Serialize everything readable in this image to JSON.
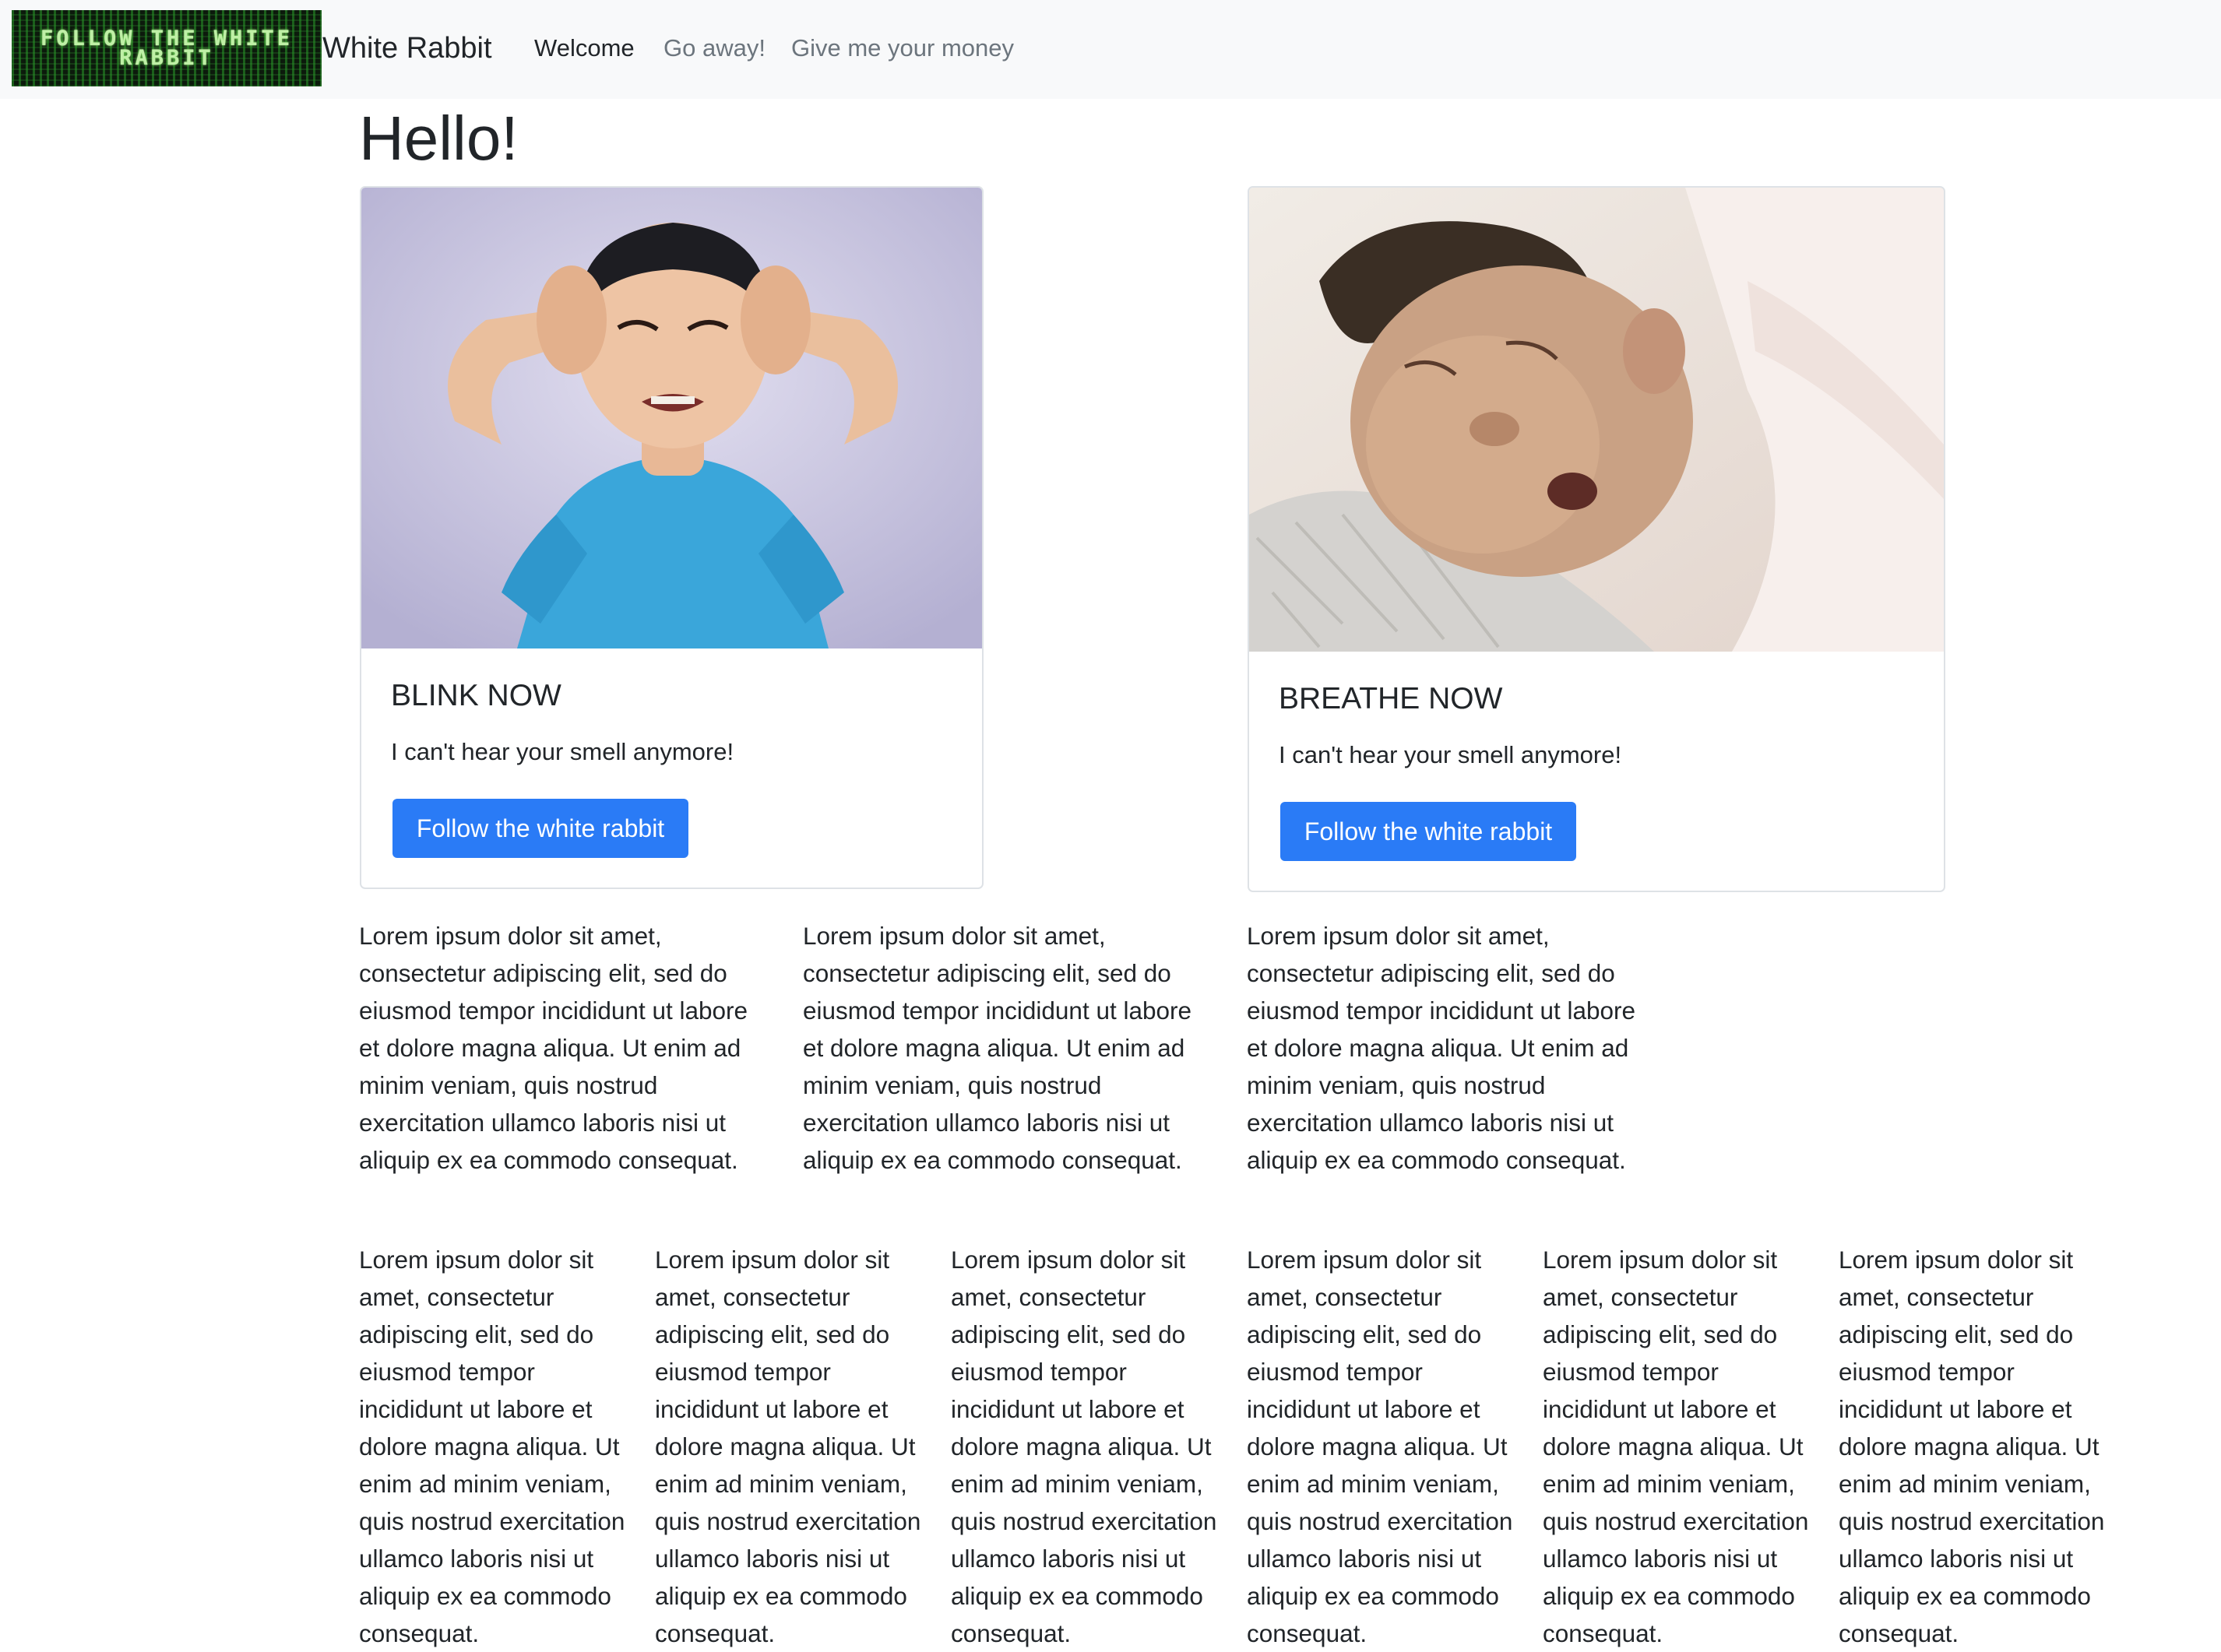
{
  "navbar": {
    "logo_text": "FOLLOW THE WHITE RABBIT",
    "brand": "White Rabbit",
    "links": [
      {
        "label": "Welcome",
        "active": true
      },
      {
        "label": "Go away!",
        "active": false
      },
      {
        "label": "Give me your money",
        "active": false
      }
    ]
  },
  "page": {
    "heading": "Hello!"
  },
  "cards": [
    {
      "title": "BLINK NOW",
      "text": "I can't hear your smell anymore!",
      "button": "Follow the white rabbit",
      "image": "photo of a boy in a blue t-shirt covering his ears"
    },
    {
      "title": "BREATHE NOW",
      "text": "I can't hear your smell anymore!",
      "button": "Follow the white rabbit",
      "image": "photo of a sleeping newborn baby"
    }
  ],
  "lorem": "Lorem ipsum dolor sit amet, consectetur adipiscing elit, sed do eiusmod tempor incididunt ut labore et dolore magna aliqua. Ut enim ad minim veniam, quis nostrud exercitation ullamco laboris nisi ut aliquip ex ea commodo consequat.",
  "theme": {
    "navbar_bg": "#f8f9fa",
    "primary": "#2a7bf6",
    "text": "#212529",
    "muted": "#6c757d"
  }
}
